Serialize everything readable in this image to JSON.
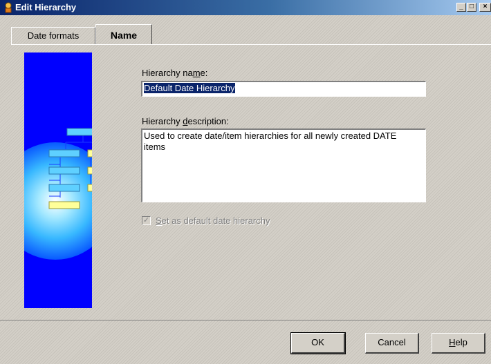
{
  "window": {
    "title": "Edit Hierarchy",
    "controls": {
      "minimize": "_",
      "maximize": "□",
      "close": "×"
    }
  },
  "tabs": [
    {
      "label": "Date formats",
      "active": false
    },
    {
      "label": "Name",
      "active": true
    }
  ],
  "form": {
    "hierarchy_name_label_pre": "Hierarchy na",
    "hierarchy_name_label_key": "m",
    "hierarchy_name_label_post": "e:",
    "hierarchy_name_value": "Default Date Hierarchy",
    "hierarchy_description_label_pre": "Hierarchy ",
    "hierarchy_description_label_key": "d",
    "hierarchy_description_label_post": "escription:",
    "hierarchy_description_value": "Used to create date/item hierarchies for all newly created DATE items",
    "default_checkbox_label_key": "S",
    "default_checkbox_label_post": "et as default date hierarchy",
    "default_checkbox_checked": true,
    "default_checkbox_enabled": false
  },
  "buttons": {
    "ok": "OK",
    "cancel": "Cancel",
    "help_key": "H",
    "help_post": "elp"
  },
  "colors": {
    "title_bar_start": "#0a246a",
    "art_background": "#0000ff",
    "selection": "#0a246a"
  },
  "icons": [
    "app-icon",
    "hierarchy-illustration"
  ]
}
